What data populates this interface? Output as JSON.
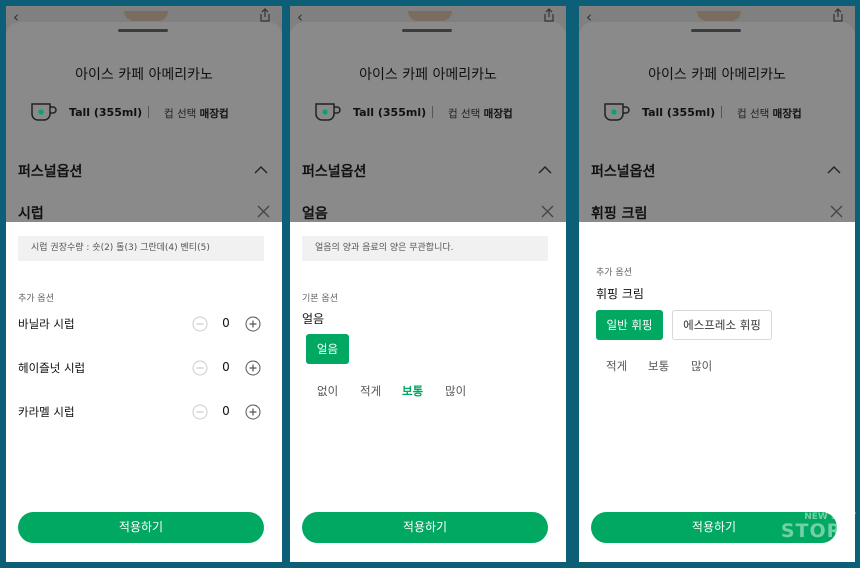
{
  "drink": {
    "name": "아이스 카페 아메리카노",
    "size": "Tall (355ml)",
    "cup_label": "컵 선택",
    "cup_value": "매장컵",
    "section_title": "퍼스널옵션"
  },
  "syrup": {
    "title": "시럽",
    "info": "시럽 권장수량 : 숏(2) 톨(3) 그란데(4) 벤티(5)",
    "extra_label": "추가 옵션",
    "items": [
      {
        "name": "바닐라 시럽",
        "qty": "0"
      },
      {
        "name": "헤이즐넛 시럽",
        "qty": "0"
      },
      {
        "name": "카라멜 시럽",
        "qty": "0"
      }
    ],
    "apply": "적용하기"
  },
  "ice": {
    "title": "얼음",
    "info": "얼음의 양과 음료의 양은 무관합니다.",
    "basic_label": "기본 옵션",
    "sub_title": "얼음",
    "chip": "얼음",
    "levels": [
      "없이",
      "적게",
      "보통",
      "많이"
    ],
    "selected_level": "보통",
    "apply": "적용하기"
  },
  "whip": {
    "title": "휘핑 크림",
    "extra_label": "추가 옵션",
    "sub_title": "휘핑 크림",
    "chips": [
      "일반 휘핑",
      "에스프레소 휘핑"
    ],
    "selected_chip": "일반 휘핑",
    "levels": [
      "적게",
      "보통",
      "많이"
    ],
    "apply": "적용하기"
  },
  "colors": {
    "accent": "#00a862",
    "frame": "#0d5f78"
  },
  "watermark": {
    "line1": "NEW SEAT",
    "line2": "STORY"
  },
  "icons": [
    "back-arrow-icon",
    "share-icon",
    "cup-icon",
    "chevron-up-icon",
    "close-icon",
    "minus-circle-icon",
    "plus-circle-icon"
  ]
}
